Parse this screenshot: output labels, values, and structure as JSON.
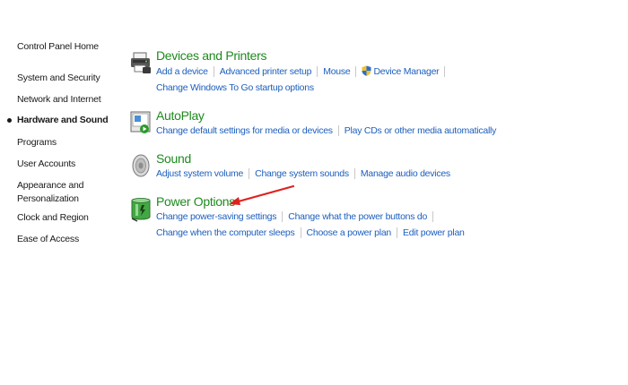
{
  "nav": {
    "home": "Control Panel Home",
    "items": [
      {
        "label": "System and Security"
      },
      {
        "label": "Network and Internet"
      },
      {
        "label": "Hardware and Sound"
      },
      {
        "label": "Programs"
      },
      {
        "label": "User Accounts"
      },
      {
        "label": "Appearance and\nPersonalization"
      },
      {
        "label": "Clock and Region"
      },
      {
        "label": "Ease of Access"
      }
    ],
    "active_index": 2
  },
  "categories": [
    {
      "title": "Devices and Printers",
      "icon": "printer-icon",
      "rows": [
        [
          "Add a device",
          "Advanced printer setup",
          "Mouse",
          "Device Manager"
        ],
        [
          "Change Windows To Go startup options"
        ]
      ]
    },
    {
      "title": "AutoPlay",
      "icon": "autoplay-icon",
      "rows": [
        [
          "Change default settings for media or devices",
          "Play CDs or other media automatically"
        ]
      ]
    },
    {
      "title": "Sound",
      "icon": "speaker-icon",
      "rows": [
        [
          "Adjust system volume",
          "Change system sounds",
          "Manage audio devices"
        ]
      ]
    },
    {
      "title": "Power Options",
      "icon": "battery-icon",
      "rows": [
        [
          "Change power-saving settings",
          "Change what the power buttons do"
        ],
        [
          "Change when the computer sleeps",
          "Choose a power plan",
          "Edit power plan"
        ]
      ]
    }
  ],
  "colors": {
    "title_green": "#1e8a1e",
    "link_blue": "#1c5fbd",
    "annotation_red": "#e0201e"
  }
}
